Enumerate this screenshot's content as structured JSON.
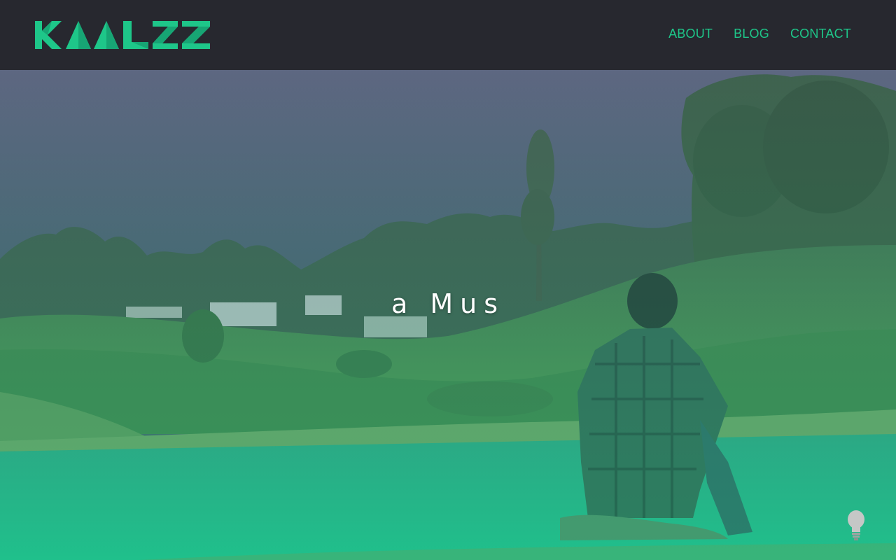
{
  "header": {
    "logo_text": "KAALZZ",
    "logo_icon": "kaalzz-logo",
    "nav": [
      {
        "label": "ABOUT"
      },
      {
        "label": "BLOG"
      },
      {
        "label": "CONTACT"
      }
    ]
  },
  "hero": {
    "headline": "a Mus",
    "image_icon": "landscape-lake-photo",
    "corner_icon": "lightbulb-icon"
  },
  "colors": {
    "header_bg": "#27282f",
    "accent": "#1ec689",
    "overlay_top": "#5c6680",
    "overlay_bottom": "#21c08a"
  }
}
